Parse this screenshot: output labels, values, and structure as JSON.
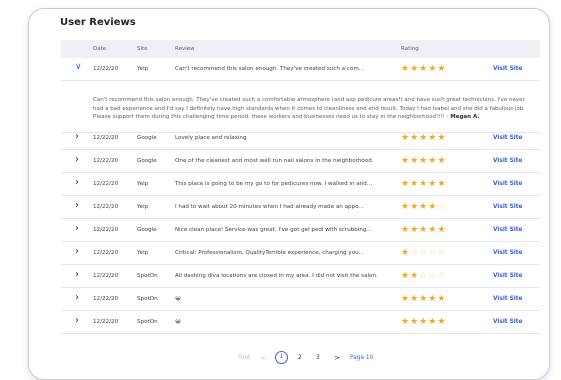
{
  "panel": {
    "title": "User Reviews"
  },
  "columns": {
    "date": "Date",
    "site": "Site",
    "review": "Review",
    "rating": "Rating"
  },
  "expanded_review": {
    "text": "Can't recommend this salon enough. They've created such a comfortable atmosphere (and asp pedicure areas!) and have such great technicians. I've never had a bad experience and I'd say I definitely have high standards when it comes to cleanliness and end result. Today I had Isabel and she did a fabulous job. Please support them during this challenging time period, these workers and businesses need us to stay in the neighborhood!!!! -",
    "author": "Megan A."
  },
  "rows": [
    {
      "date": "12/22/20",
      "site": "Yelp",
      "review": "Can't recommend this salon enough. They've created such a com...",
      "rating": 5,
      "link": "Visit Site",
      "expanded": true
    },
    {
      "date": "12/22/20",
      "site": "Google",
      "review": "Lovely place and relaxing",
      "rating": 5,
      "link": "Visit Site",
      "expanded": false
    },
    {
      "date": "12/22/20",
      "site": "Google",
      "review": "One of the cleanest and most well run nail salons in the neighborhood.",
      "rating": 5,
      "link": "Visit Site",
      "expanded": false
    },
    {
      "date": "12/22/20",
      "site": "Yelp",
      "review": "This place is going to be my go to for pedicures now. I walked in and...",
      "rating": 5,
      "link": "Visit Site",
      "expanded": false
    },
    {
      "date": "12/22/20",
      "site": "Yelp",
      "review": "I had to wait about 20 minutes when I had already made an appo...",
      "rating": 4,
      "link": "Visit Site",
      "expanded": false
    },
    {
      "date": "12/22/20",
      "site": "Google",
      "review": "Nice clean place! Service was great. I've got gel pedi with scrubbing...",
      "rating": 5,
      "link": "Visit Site",
      "expanded": false
    },
    {
      "date": "12/22/20",
      "site": "Yelp",
      "review": "Critical: Professionalism, QualityTerrible experience, charging you...",
      "rating": 1,
      "link": "Visit Site",
      "expanded": false
    },
    {
      "date": "12/22/20",
      "site": "SpotOn",
      "review": "All dashing diva locations are closed in my area. I did not visit the salon.",
      "rating": 2,
      "link": "Visit Site",
      "expanded": false
    },
    {
      "date": "12/22/20",
      "site": "SpotOn",
      "review": "😀",
      "rating": 5,
      "link": "Visit Site",
      "expanded": false
    },
    {
      "date": "12/22/20",
      "site": "SpotOn",
      "review": "😀",
      "rating": 5,
      "link": "Visit Site",
      "expanded": false
    }
  ],
  "pagination": {
    "first": "First",
    "prev": "<",
    "pages": [
      "1",
      "2",
      "3"
    ],
    "current": "1",
    "next": ">",
    "last": "Page 10"
  }
}
